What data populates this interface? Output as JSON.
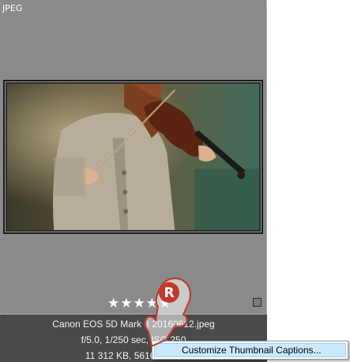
{
  "thumbnail": {
    "format_label": "JPEG",
    "rating_stars": "★★★★★",
    "rating_value": 5,
    "selected": false
  },
  "caption": {
    "line1": "Canon EOS 5D Mark II 20160612.jpeg",
    "line2": "f/5.0, 1/250 sec, ISO 250",
    "line3": "11 312 KB, 5616×3744"
  },
  "context_menu": {
    "items": [
      {
        "label": "Customize Thumbnail Captions..."
      }
    ]
  },
  "cursor": {
    "icon": "hand-pointer-icon",
    "badge_letter": "R",
    "color": "#c0392b"
  },
  "colors": {
    "cell_background": "#8a8a8a",
    "caption_background": "#4a4a4a",
    "menu_highlight": "#cce8ff"
  }
}
